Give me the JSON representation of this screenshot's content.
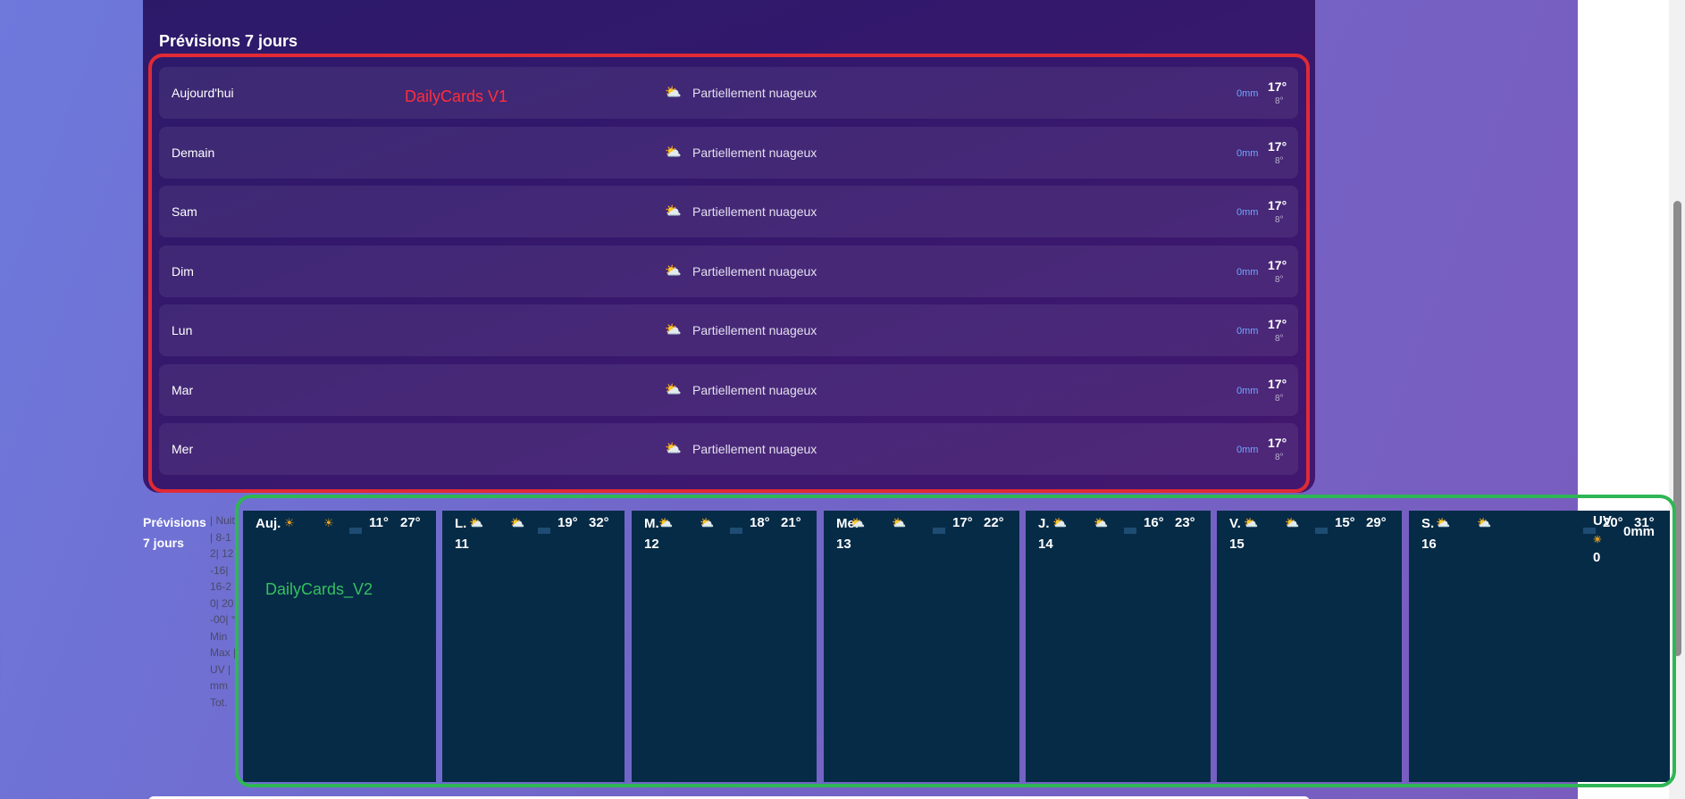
{
  "v1": {
    "title": "Prévisions 7 jours",
    "annotation": "DailyCards V1",
    "rows": [
      {
        "day": "Aujourd'hui",
        "icon": "sun-behind-cloud-icon",
        "condition": "Partiellement nuageux",
        "rain": "0mm",
        "max": "17°",
        "min": "8°"
      },
      {
        "day": "Demain",
        "icon": "sun-behind-cloud-icon",
        "condition": "Partiellement nuageux",
        "rain": "0mm",
        "max": "17°",
        "min": "8°"
      },
      {
        "day": "Sam",
        "icon": "sun-behind-cloud-icon",
        "condition": "Partiellement nuageux",
        "rain": "0mm",
        "max": "17°",
        "min": "8°"
      },
      {
        "day": "Dim",
        "icon": "sun-behind-cloud-icon",
        "condition": "Partiellement nuageux",
        "rain": "0mm",
        "max": "17°",
        "min": "8°"
      },
      {
        "day": "Lun",
        "icon": "sun-behind-cloud-icon",
        "condition": "Partiellement nuageux",
        "rain": "0mm",
        "max": "17°",
        "min": "8°"
      },
      {
        "day": "Mar",
        "icon": "sun-behind-cloud-icon",
        "condition": "Partiellement nuageux",
        "rain": "0mm",
        "max": "17°",
        "min": "8°"
      },
      {
        "day": "Mer",
        "icon": "sun-behind-cloud-icon",
        "condition": "Partiellement nuageux",
        "rain": "0mm",
        "max": "17°",
        "min": "8°"
      }
    ]
  },
  "v2": {
    "title": "Prévisions 7 jours",
    "legend": "| Nuit| 8-12| 12-16| 16-20| 20-00| °Min Max | UV | mm Tot.",
    "annotation": "DailyCards_V2",
    "cards": [
      {
        "day": "Auj.",
        "date": "",
        "min": "11°",
        "max": "27°",
        "icon": "sun-icon"
      },
      {
        "day": "L.",
        "date": "11",
        "min": "19°",
        "max": "32°",
        "icon": "cloud-sun-icon"
      },
      {
        "day": "M.",
        "date": "12",
        "min": "18°",
        "max": "21°",
        "icon": "cloud-sun-icon"
      },
      {
        "day": "Me.",
        "date": "13",
        "min": "17°",
        "max": "22°",
        "icon": "cloud-sun-icon"
      },
      {
        "day": "J.",
        "date": "14",
        "min": "16°",
        "max": "23°",
        "icon": "cloud-sun-icon"
      },
      {
        "day": "V.",
        "date": "15",
        "min": "15°",
        "max": "29°",
        "icon": "cloud-sun-icon"
      },
      {
        "day": "S.",
        "date": "16",
        "min": "20°",
        "max": "31°",
        "icon": "cloud-sun-icon"
      }
    ],
    "tail": {
      "uv_label": "UV",
      "uv_value": "0",
      "rain_total": "0mm"
    }
  },
  "colors": {
    "v1_outline": "#e12a35",
    "v2_outline": "#2fb655",
    "rain_text": "#6ea8ff",
    "v2_card_bg": "#062b47"
  }
}
